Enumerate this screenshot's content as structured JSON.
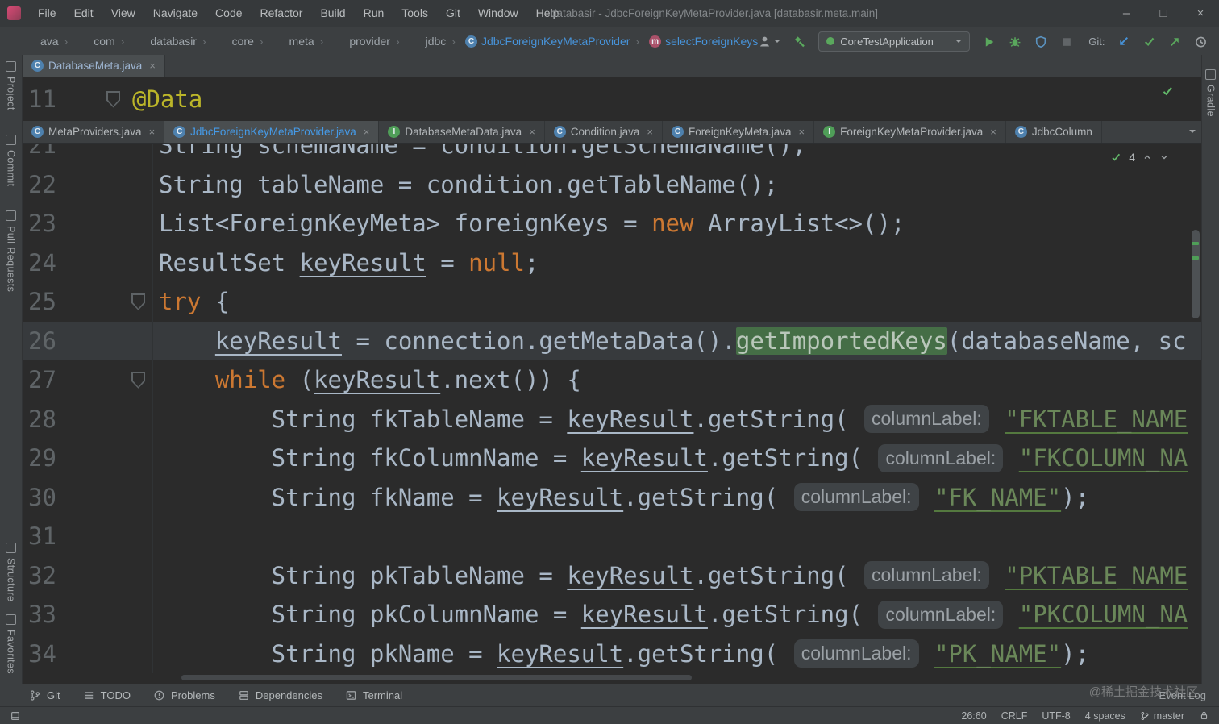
{
  "colors": {
    "editor_bg": "#2b2b2b",
    "panel_bg": "#3c3f41",
    "keyword_orange": "#cc7832",
    "string_green": "#6a8759",
    "annotation_yellow": "#bbb529",
    "accent_blue": "#4793d9",
    "run_green": "#5aa85d"
  },
  "window": {
    "title": "databasir - JdbcForeignKeyMetaProvider.java [databasir.meta.main]",
    "controls": {
      "minimize": "–",
      "maximize": "□",
      "close": "×"
    }
  },
  "menu": {
    "items": [
      "File",
      "Edit",
      "View",
      "Navigate",
      "Code",
      "Refactor",
      "Build",
      "Run",
      "Tools",
      "Git",
      "Window",
      "Help"
    ]
  },
  "breadcrumbs": [
    {
      "label": "ava"
    },
    {
      "label": "com"
    },
    {
      "label": "databasir"
    },
    {
      "label": "core"
    },
    {
      "label": "meta"
    },
    {
      "label": "provider"
    },
    {
      "label": "jdbc"
    },
    {
      "label": "JdbcForeignKeyMetaProvider",
      "icon": "class",
      "accent": true
    },
    {
      "label": "selectForeignKeys",
      "icon": "method",
      "accent": true
    }
  ],
  "toolbar": {
    "run_config": "CoreTestApplication",
    "git_label": "Git:"
  },
  "stripes": {
    "left_top": [
      {
        "label": "Project"
      },
      {
        "label": "Commit"
      },
      {
        "label": "Pull Requests"
      }
    ],
    "left_bottom": [
      {
        "label": "Structure"
      },
      {
        "label": "Favorites"
      }
    ],
    "right": [
      {
        "label": "Gradle"
      }
    ]
  },
  "peek_editor": {
    "tab_label": "DatabaseMeta.java",
    "line_number": "11",
    "annotation": "@Data"
  },
  "tabs": [
    {
      "label": "MetaProviders.java",
      "icon": "class"
    },
    {
      "label": "JdbcForeignKeyMetaProvider.java",
      "icon": "class",
      "selected": true
    },
    {
      "label": "DatabaseMetaData.java",
      "icon": "interface"
    },
    {
      "label": "Condition.java",
      "icon": "class"
    },
    {
      "label": "ForeignKeyMeta.java",
      "icon": "class"
    },
    {
      "label": "ForeignKeyMetaProvider.java",
      "icon": "interface"
    },
    {
      "label": "JdbcColumn",
      "icon": "class",
      "hide_close": true
    }
  ],
  "editor": {
    "inspection_count": "4",
    "lines": [
      {
        "n": "21",
        "tokens": [
          [
            "p",
            "String schemaName = condition.getSchemaName();"
          ]
        ]
      },
      {
        "n": "22",
        "tokens": [
          [
            "p",
            "String tableName = condition.getTableName();"
          ]
        ]
      },
      {
        "n": "23",
        "tokens": [
          [
            "p",
            "List<ForeignKeyMeta> foreignKeys = "
          ],
          [
            "k",
            "new"
          ],
          [
            "p",
            " ArrayList<>();"
          ]
        ]
      },
      {
        "n": "24",
        "tokens": [
          [
            "p",
            "ResultSet "
          ],
          [
            "v",
            "keyResult"
          ],
          [
            "p",
            " = "
          ],
          [
            "k",
            "null"
          ],
          [
            "p",
            ";"
          ]
        ]
      },
      {
        "n": "25",
        "fold": true,
        "tokens": [
          [
            "k",
            "try"
          ],
          [
            "p",
            " {"
          ]
        ]
      },
      {
        "n": "26",
        "current": true,
        "tokens": [
          [
            "p",
            "    "
          ],
          [
            "v",
            "keyResult"
          ],
          [
            "p",
            " = connection.getMetaData()."
          ],
          [
            "g",
            "getImportedKeys"
          ],
          [
            "p",
            "(databaseName, sc"
          ]
        ]
      },
      {
        "n": "27",
        "fold": true,
        "tokens": [
          [
            "p",
            "    "
          ],
          [
            "k",
            "while"
          ],
          [
            "p",
            " ("
          ],
          [
            "v",
            "keyResult"
          ],
          [
            "p",
            ".next()) {"
          ]
        ]
      },
      {
        "n": "28",
        "tokens": [
          [
            "p",
            "        String fkTableName = "
          ],
          [
            "v",
            "keyResult"
          ],
          [
            "p",
            ".getString( "
          ],
          [
            "h",
            "columnLabel:"
          ],
          [
            "p",
            " "
          ],
          [
            "s",
            "\"FKTABLE_NAME"
          ]
        ]
      },
      {
        "n": "29",
        "tokens": [
          [
            "p",
            "        String fkColumnName = "
          ],
          [
            "v",
            "keyResult"
          ],
          [
            "p",
            ".getString( "
          ],
          [
            "h",
            "columnLabel:"
          ],
          [
            "p",
            " "
          ],
          [
            "s",
            "\"FKCOLUMN_NA"
          ]
        ]
      },
      {
        "n": "30",
        "tokens": [
          [
            "p",
            "        String fkName = "
          ],
          [
            "v",
            "keyResult"
          ],
          [
            "p",
            ".getString( "
          ],
          [
            "h",
            "columnLabel:"
          ],
          [
            "p",
            " "
          ],
          [
            "s",
            "\"FK_NAME\""
          ],
          [
            "p",
            ");"
          ]
        ]
      },
      {
        "n": "31",
        "tokens": []
      },
      {
        "n": "32",
        "tokens": [
          [
            "p",
            "        String pkTableName = "
          ],
          [
            "v",
            "keyResult"
          ],
          [
            "p",
            ".getString( "
          ],
          [
            "h",
            "columnLabel:"
          ],
          [
            "p",
            " "
          ],
          [
            "s",
            "\"PKTABLE_NAME"
          ]
        ]
      },
      {
        "n": "33",
        "tokens": [
          [
            "p",
            "        String pkColumnName = "
          ],
          [
            "v",
            "keyResult"
          ],
          [
            "p",
            ".getString( "
          ],
          [
            "h",
            "columnLabel:"
          ],
          [
            "p",
            " "
          ],
          [
            "s",
            "\"PKCOLUMN_NA"
          ]
        ]
      },
      {
        "n": "34",
        "tokens": [
          [
            "p",
            "        String pkName = "
          ],
          [
            "v",
            "keyResult"
          ],
          [
            "p",
            ".getString( "
          ],
          [
            "h",
            "columnLabel:"
          ],
          [
            "p",
            " "
          ],
          [
            "s",
            "\"PK_NAME\""
          ],
          [
            "p",
            ");"
          ]
        ]
      }
    ]
  },
  "bottom_bar": {
    "git": "Git",
    "todo": "TODO",
    "problems": "Problems",
    "dependencies": "Dependencies",
    "terminal": "Terminal",
    "event_log": "Event Log"
  },
  "status_bar": {
    "position": "26:60",
    "line_separator": "CRLF",
    "encoding": "UTF-8",
    "indent": "4 spaces",
    "branch": "master"
  },
  "watermark": "@稀土掘金技术社区"
}
